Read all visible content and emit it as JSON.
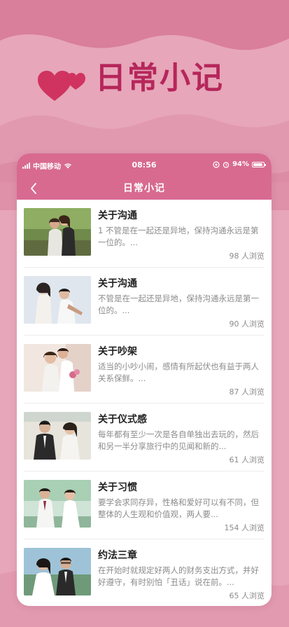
{
  "hero": {
    "title": "日常小记"
  },
  "status_bar": {
    "carrier": "中国移动",
    "time": "08:56",
    "battery": "94%"
  },
  "nav": {
    "title": "日常小记"
  },
  "articles": [
    {
      "title": "关于沟通",
      "description": "1 不管是在一起还是异地，保持沟通永远是第一位的。...",
      "views": "98 人浏览"
    },
    {
      "title": "关于沟通",
      "description": "不管是在一起还是异地，保持沟通永远是第一位的。...",
      "views": "90 人浏览"
    },
    {
      "title": "关于吵架",
      "description": "适当的小吵小闹，感情有所起伏也有益于两人关系保鲜。...",
      "views": "87 人浏览"
    },
    {
      "title": "关于仪式感",
      "description": "每年都有至少一次是各自单独出去玩的，然后和另一半分享旅行中的见闻和新的...",
      "views": "61 人浏览"
    },
    {
      "title": "关于习惯",
      "description": "要学会求同存异，性格和爱好可以有不同，但整体的人生观和价值观，两人要...",
      "views": "154 人浏览"
    },
    {
      "title": "约法三章",
      "description": "在开始时就规定好两人的财务支出方式，并好好遵守，有时别怕「丑话」说在前。...",
      "views": "65 人浏览"
    }
  ],
  "colors": {
    "brand": "#b6265a",
    "header": "#d86a90",
    "background": "#e7a6ba"
  }
}
